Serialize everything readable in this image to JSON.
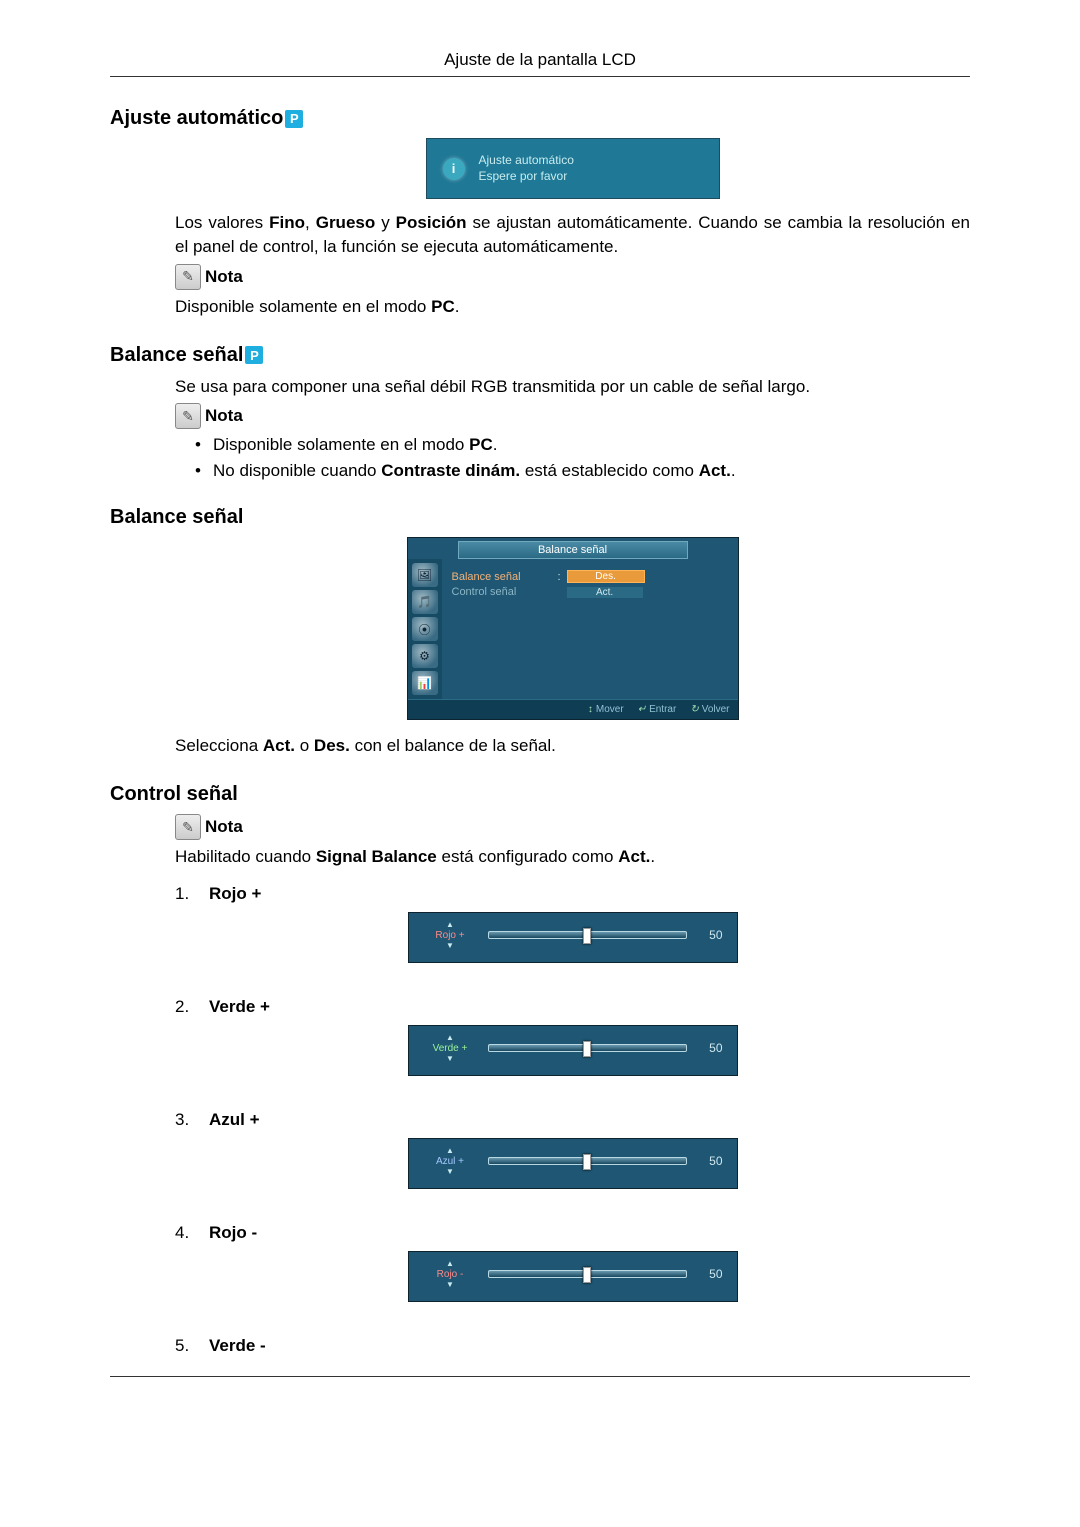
{
  "page_header": "Ajuste de la pantalla LCD",
  "section1": {
    "title": "Ajuste automático",
    "banner_line1": "Ajuste automático",
    "banner_line2": "Espere por favor",
    "para_prefix": "Los valores ",
    "bold1": "Fino",
    "sep1": ", ",
    "bold2": "Grueso",
    "sep2": " y ",
    "bold3": "Posición",
    "para_suffix": " se ajustan automáticamente. Cuando se cambia la resolución en el panel de control, la función se ejecuta automáticamente.",
    "note_label": "Nota",
    "note_text_prefix": "Disponible solamente en el modo ",
    "note_text_bold": "PC",
    "note_text_suffix": "."
  },
  "section2": {
    "title": "Balance señal",
    "para": "Se usa para componer una señal débil RGB transmitida por un cable de señal largo.",
    "note_label": "Nota",
    "bullet1_prefix": "Disponible solamente en el modo ",
    "bullet1_bold": "PC",
    "bullet1_suffix": ".",
    "bullet2_prefix": "No disponible cuando ",
    "bullet2_bold1": "Contraste dinám.",
    "bullet2_mid": " está establecido como ",
    "bullet2_bold2": "Act.",
    "bullet2_suffix": "."
  },
  "section3": {
    "title": "Balance señal",
    "osd": {
      "title": "Balance señal",
      "item1": "Balance señal",
      "item2": "Control señal",
      "opt1": "Des.",
      "opt2": "Act.",
      "foot_move": "Mover",
      "foot_enter": "Entrar",
      "foot_return": "Volver"
    },
    "para_prefix": "Selecciona ",
    "para_b1": "Act.",
    "para_mid": " o ",
    "para_b2": "Des.",
    "para_suffix": " con el balance de la señal."
  },
  "section4": {
    "title": "Control señal",
    "note_label": "Nota",
    "note_prefix": "Habilitado cuando ",
    "note_bold1": "Signal Balance",
    "note_mid": " está configurado como ",
    "note_bold2": "Act.",
    "note_suffix": ".",
    "items": [
      {
        "num": "1.",
        "label": "Rojo +",
        "slider_name": "Rojo +",
        "value": "50",
        "color": "slider-red"
      },
      {
        "num": "2.",
        "label": "Verde +",
        "slider_name": "Verde +",
        "value": "50",
        "color": "slider-green"
      },
      {
        "num": "3.",
        "label": "Azul +",
        "slider_name": "Azul +",
        "value": "50",
        "color": "slider-blue"
      },
      {
        "num": "4.",
        "label": "Rojo -",
        "slider_name": "Rojo -",
        "value": "50",
        "color": "slider-red"
      },
      {
        "num": "5.",
        "label": "Verde -",
        "slider_name": "",
        "value": "",
        "color": ""
      }
    ]
  }
}
